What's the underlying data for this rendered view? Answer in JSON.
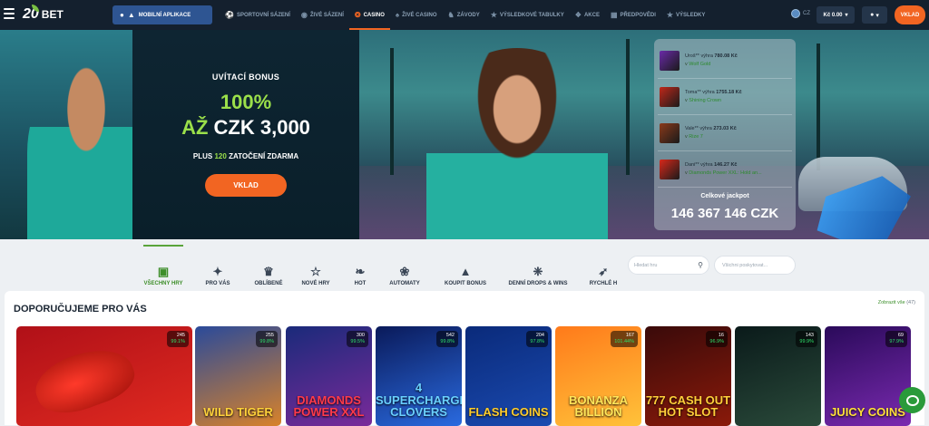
{
  "topbar": {
    "logo_num": "20",
    "logo_bet": "BET",
    "app_button": "MOBILNÍ APLIKACE",
    "nav": [
      {
        "label": "SPORTOVNÍ SÁZENÍ",
        "icon": "soccer-ball-icon"
      },
      {
        "label": "ŽIVÉ SÁZENÍ",
        "icon": "live-icon"
      },
      {
        "label": "CASINO",
        "icon": "casino-chip-icon",
        "active": true
      },
      {
        "label": "ŽIVÉ CASINO",
        "icon": "cards-icon"
      },
      {
        "label": "ZÁVODY",
        "icon": "horse-icon"
      },
      {
        "label": "VÝSLEDKOVÉ TABULKY",
        "icon": "trophy-icon"
      },
      {
        "label": "AKCE",
        "icon": "gift-icon"
      },
      {
        "label": "PŘEDPOVĚDI",
        "icon": "calendar-icon"
      },
      {
        "label": "VÝSLEDKY",
        "icon": "trophy-icon"
      }
    ],
    "language": "CZ",
    "balance": "Kč 0.00",
    "deposit": "VKLAD"
  },
  "hero": {
    "bonus_title": "UVÍTACÍ BONUS",
    "bonus_pct": "100%",
    "bonus_az": "AŽ",
    "bonus_amount": "CZK 3,000",
    "spins_prefix": "PLUS",
    "spins_num": "120",
    "spins_suffix": "ZATOČENÍ ZDARMA",
    "deposit_button": "VKLAD"
  },
  "winners": [
    {
      "user": "Uroš**",
      "verb": "výhra",
      "amount": "780.08 Kč",
      "prefix": "v",
      "game": "Wolf Gold",
      "color": "#6a2aa8"
    },
    {
      "user": "Toma**",
      "verb": "výhra",
      "amount": "1755.18 Kč",
      "prefix": "v",
      "game": "Shining Crown",
      "color": "#c0281a"
    },
    {
      "user": "Vale**",
      "verb": "výhra",
      "amount": "273.03 Kč",
      "prefix": "v",
      "game": "Rize 7",
      "color": "#8a3a1a"
    },
    {
      "user": "Dani**",
      "verb": "výhra",
      "amount": "146.27 Kč",
      "prefix": "v",
      "game": "Diamonds Power XXL: Hold an...",
      "color": "#d8281a"
    }
  ],
  "jackpot": {
    "label": "Celkové jackpot",
    "value": "146 367 146 CZK"
  },
  "categories": [
    {
      "label": "VŠECHNY HRY",
      "icon": "slot-icon",
      "active": true
    },
    {
      "label": "PRO VÁS",
      "icon": "network-icon"
    },
    {
      "label": "OBLÍBENÉ",
      "icon": "crown-icon"
    },
    {
      "label": "NOVÉ HRY",
      "icon": "star-icon"
    },
    {
      "label": "HOT",
      "icon": "pepper-icon"
    },
    {
      "label": "AUTOMATY",
      "icon": "cherry-icon"
    },
    {
      "label": "KOUPIT BONUS",
      "icon": "bag-icon"
    },
    {
      "label": "DENNÍ DROPS & WINS",
      "icon": "drops-icon"
    },
    {
      "label": "RYCHLÉ H",
      "icon": "rocket-icon"
    }
  ],
  "search": {
    "placeholder": "Hledat hru"
  },
  "providers": {
    "placeholder": "Všichni poskytovat..."
  },
  "recommended": {
    "title": "DOPORUČUJEME PRO VÁS",
    "show_all": "Zobrazit vše",
    "count": "(47)"
  },
  "games": [
    {
      "name": "",
      "players": "245",
      "rtp": "99.1%",
      "colors": [
        "#b01018",
        "#e02a20"
      ],
      "name_color": "#fff"
    },
    {
      "name": "WILD TIGER",
      "players": "255",
      "rtp": "99.8%",
      "colors": [
        "#2a4a9a",
        "#d8822a"
      ],
      "name_color": "#ffd23a"
    },
    {
      "name": "DIAMONDS POWER XXL",
      "players": "300",
      "rtp": "99.5%",
      "colors": [
        "#1a2a7a",
        "#7a2a9a"
      ],
      "name_color": "#ff3a4a"
    },
    {
      "name": "4 SUPERCHARGED CLOVERS",
      "players": "542",
      "rtp": "99.8%",
      "colors": [
        "#0a1a5a",
        "#2a6adf"
      ],
      "name_color": "#6ad0ff"
    },
    {
      "name": "FLASH COINS",
      "players": "204",
      "rtp": "97.8%",
      "colors": [
        "#0a2a7a",
        "#1a4ab0"
      ],
      "name_color": "#ffcc2a"
    },
    {
      "name": "BONANZA BILLION",
      "players": "167",
      "rtp": "101.44%",
      "colors": [
        "#ff7a1a",
        "#ffc23a"
      ],
      "name_color": "#ffe65a"
    },
    {
      "name": "777 CASH OUT HOT SLOT",
      "players": "16",
      "rtp": "96.9%",
      "colors": [
        "#3a0a0a",
        "#8a1a0a"
      ],
      "name_color": "#ffcf3a"
    },
    {
      "name": "",
      "players": "143",
      "rtp": "99.9%",
      "colors": [
        "#0a1a1a",
        "#2a4a3a"
      ],
      "name_color": "#cfd8c0"
    },
    {
      "name": "JUICY COINS",
      "players": "69",
      "rtp": "97.9%",
      "colors": [
        "#2a0a5a",
        "#7a2ab0"
      ],
      "name_color": "#ffe03a"
    }
  ]
}
